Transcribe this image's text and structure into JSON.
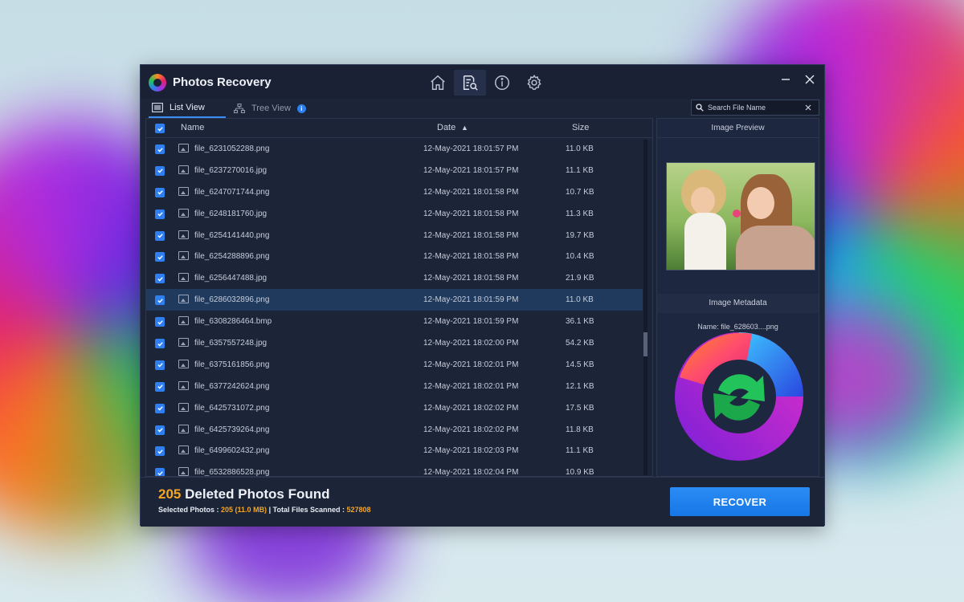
{
  "window": {
    "title": "Photos Recovery",
    "nav_icons": [
      "home-icon",
      "scan-results-icon",
      "info-icon",
      "settings-icon"
    ],
    "controls": [
      "minimize-icon",
      "close-icon"
    ]
  },
  "tabs": [
    {
      "label": "List View",
      "icon": "list-icon",
      "active": true
    },
    {
      "label": "Tree View",
      "icon": "tree-icon",
      "active": false,
      "badge": "i"
    }
  ],
  "search": {
    "placeholder": "Search File Name"
  },
  "table": {
    "columns": {
      "name": "Name",
      "date": "Date",
      "size": "Size",
      "sort_indicator": "▲"
    },
    "rows": [
      {
        "name": "file_6231052288.png",
        "date": "12-May-2021 18:01:57 PM",
        "size": "11.0 KB"
      },
      {
        "name": "file_6237270016.jpg",
        "date": "12-May-2021 18:01:57 PM",
        "size": "11.1 KB"
      },
      {
        "name": "file_6247071744.png",
        "date": "12-May-2021 18:01:58 PM",
        "size": "10.7 KB"
      },
      {
        "name": "file_6248181760.jpg",
        "date": "12-May-2021 18:01:58 PM",
        "size": "11.3 KB"
      },
      {
        "name": "file_6254141440.png",
        "date": "12-May-2021 18:01:58 PM",
        "size": "19.7 KB"
      },
      {
        "name": "file_6254288896.png",
        "date": "12-May-2021 18:01:58 PM",
        "size": "10.4 KB"
      },
      {
        "name": "file_6256447488.jpg",
        "date": "12-May-2021 18:01:58 PM",
        "size": "21.9 KB"
      },
      {
        "name": "file_6286032896.png",
        "date": "12-May-2021 18:01:59 PM",
        "size": "11.0 KB",
        "selected": true
      },
      {
        "name": "file_6308286464.bmp",
        "date": "12-May-2021 18:01:59 PM",
        "size": "36.1 KB"
      },
      {
        "name": "file_6357557248.jpg",
        "date": "12-May-2021 18:02:00 PM",
        "size": "54.2 KB"
      },
      {
        "name": "file_6375161856.png",
        "date": "12-May-2021 18:02:01 PM",
        "size": "14.5 KB"
      },
      {
        "name": "file_6377242624.png",
        "date": "12-May-2021 18:02:01 PM",
        "size": "12.1 KB"
      },
      {
        "name": "file_6425731072.png",
        "date": "12-May-2021 18:02:02 PM",
        "size": "17.5 KB"
      },
      {
        "name": "file_6425739264.png",
        "date": "12-May-2021 18:02:02 PM",
        "size": "11.8 KB"
      },
      {
        "name": "file_6499602432.png",
        "date": "12-May-2021 18:02:03 PM",
        "size": "11.1 KB"
      },
      {
        "name": "file_6532886528.png",
        "date": "12-May-2021 18:02:04 PM",
        "size": "10.9 KB"
      }
    ]
  },
  "preview": {
    "heading": "Image Preview",
    "metadata_heading": "Image Metadata",
    "metadata_name_label": "Name:",
    "metadata_name_value": "file_628603....png"
  },
  "footer": {
    "found_count": "205",
    "found_label": "Deleted Photos Found",
    "selected_label": "Selected Photos :",
    "selected_value": "205 (11.0 MB)",
    "separator": "|",
    "scanned_label": "Total Files Scanned :",
    "scanned_value": "527808",
    "recover_label": "RECOVER"
  },
  "colors": {
    "accent": "#2f7ff0",
    "highlight": "#f5a623",
    "window_bg": "#1c2438",
    "selected_row": "#1f3a5c"
  }
}
